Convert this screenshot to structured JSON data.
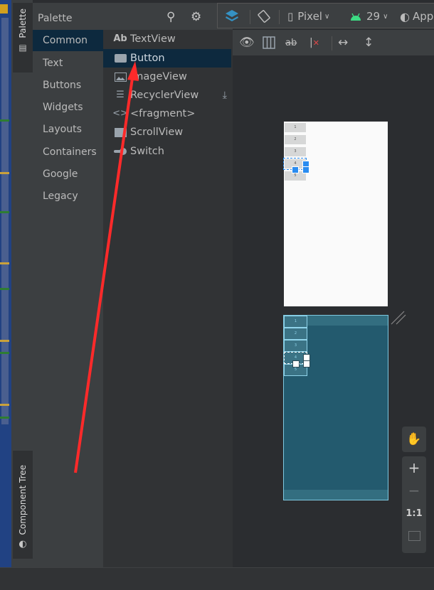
{
  "side_tabs": {
    "palette": "Palette",
    "component_tree": "Component Tree"
  },
  "palette": {
    "title": "Palette",
    "categories": [
      {
        "label": "Common",
        "selected": true
      },
      {
        "label": "Text",
        "selected": false
      },
      {
        "label": "Buttons",
        "selected": false
      },
      {
        "label": "Widgets",
        "selected": false
      },
      {
        "label": "Layouts",
        "selected": false
      },
      {
        "label": "Containers",
        "selected": false
      },
      {
        "label": "Google",
        "selected": false
      },
      {
        "label": "Legacy",
        "selected": false
      }
    ],
    "items": [
      {
        "label": "TextView",
        "icon": "Ab",
        "selected": false
      },
      {
        "label": "Button",
        "icon": "button-icon",
        "selected": true
      },
      {
        "label": "ImageView",
        "icon": "image-icon",
        "selected": false
      },
      {
        "label": "RecyclerView",
        "icon": "list-icon",
        "selected": false,
        "download": true
      },
      {
        "label": "<fragment>",
        "icon": "code-icon",
        "selected": false
      },
      {
        "label": "ScrollView",
        "icon": "scrollview-icon",
        "selected": false
      },
      {
        "label": "Switch",
        "icon": "switch-icon",
        "selected": false
      }
    ]
  },
  "toolbar": {
    "device": "Pixel",
    "api_level": "29",
    "theme": "App"
  },
  "preview": {
    "buttons": [
      "1",
      "2",
      "3",
      "4",
      "5"
    ],
    "selected_index": 3
  },
  "zoom_controls": {
    "one_to_one": "1:1"
  },
  "colors": {
    "accent": "#2a8cf0",
    "selection_bg": "#0d293e",
    "blueprint": "#235a6e",
    "android_green": "#3ddc84",
    "arrow": "#ff2a2a"
  }
}
